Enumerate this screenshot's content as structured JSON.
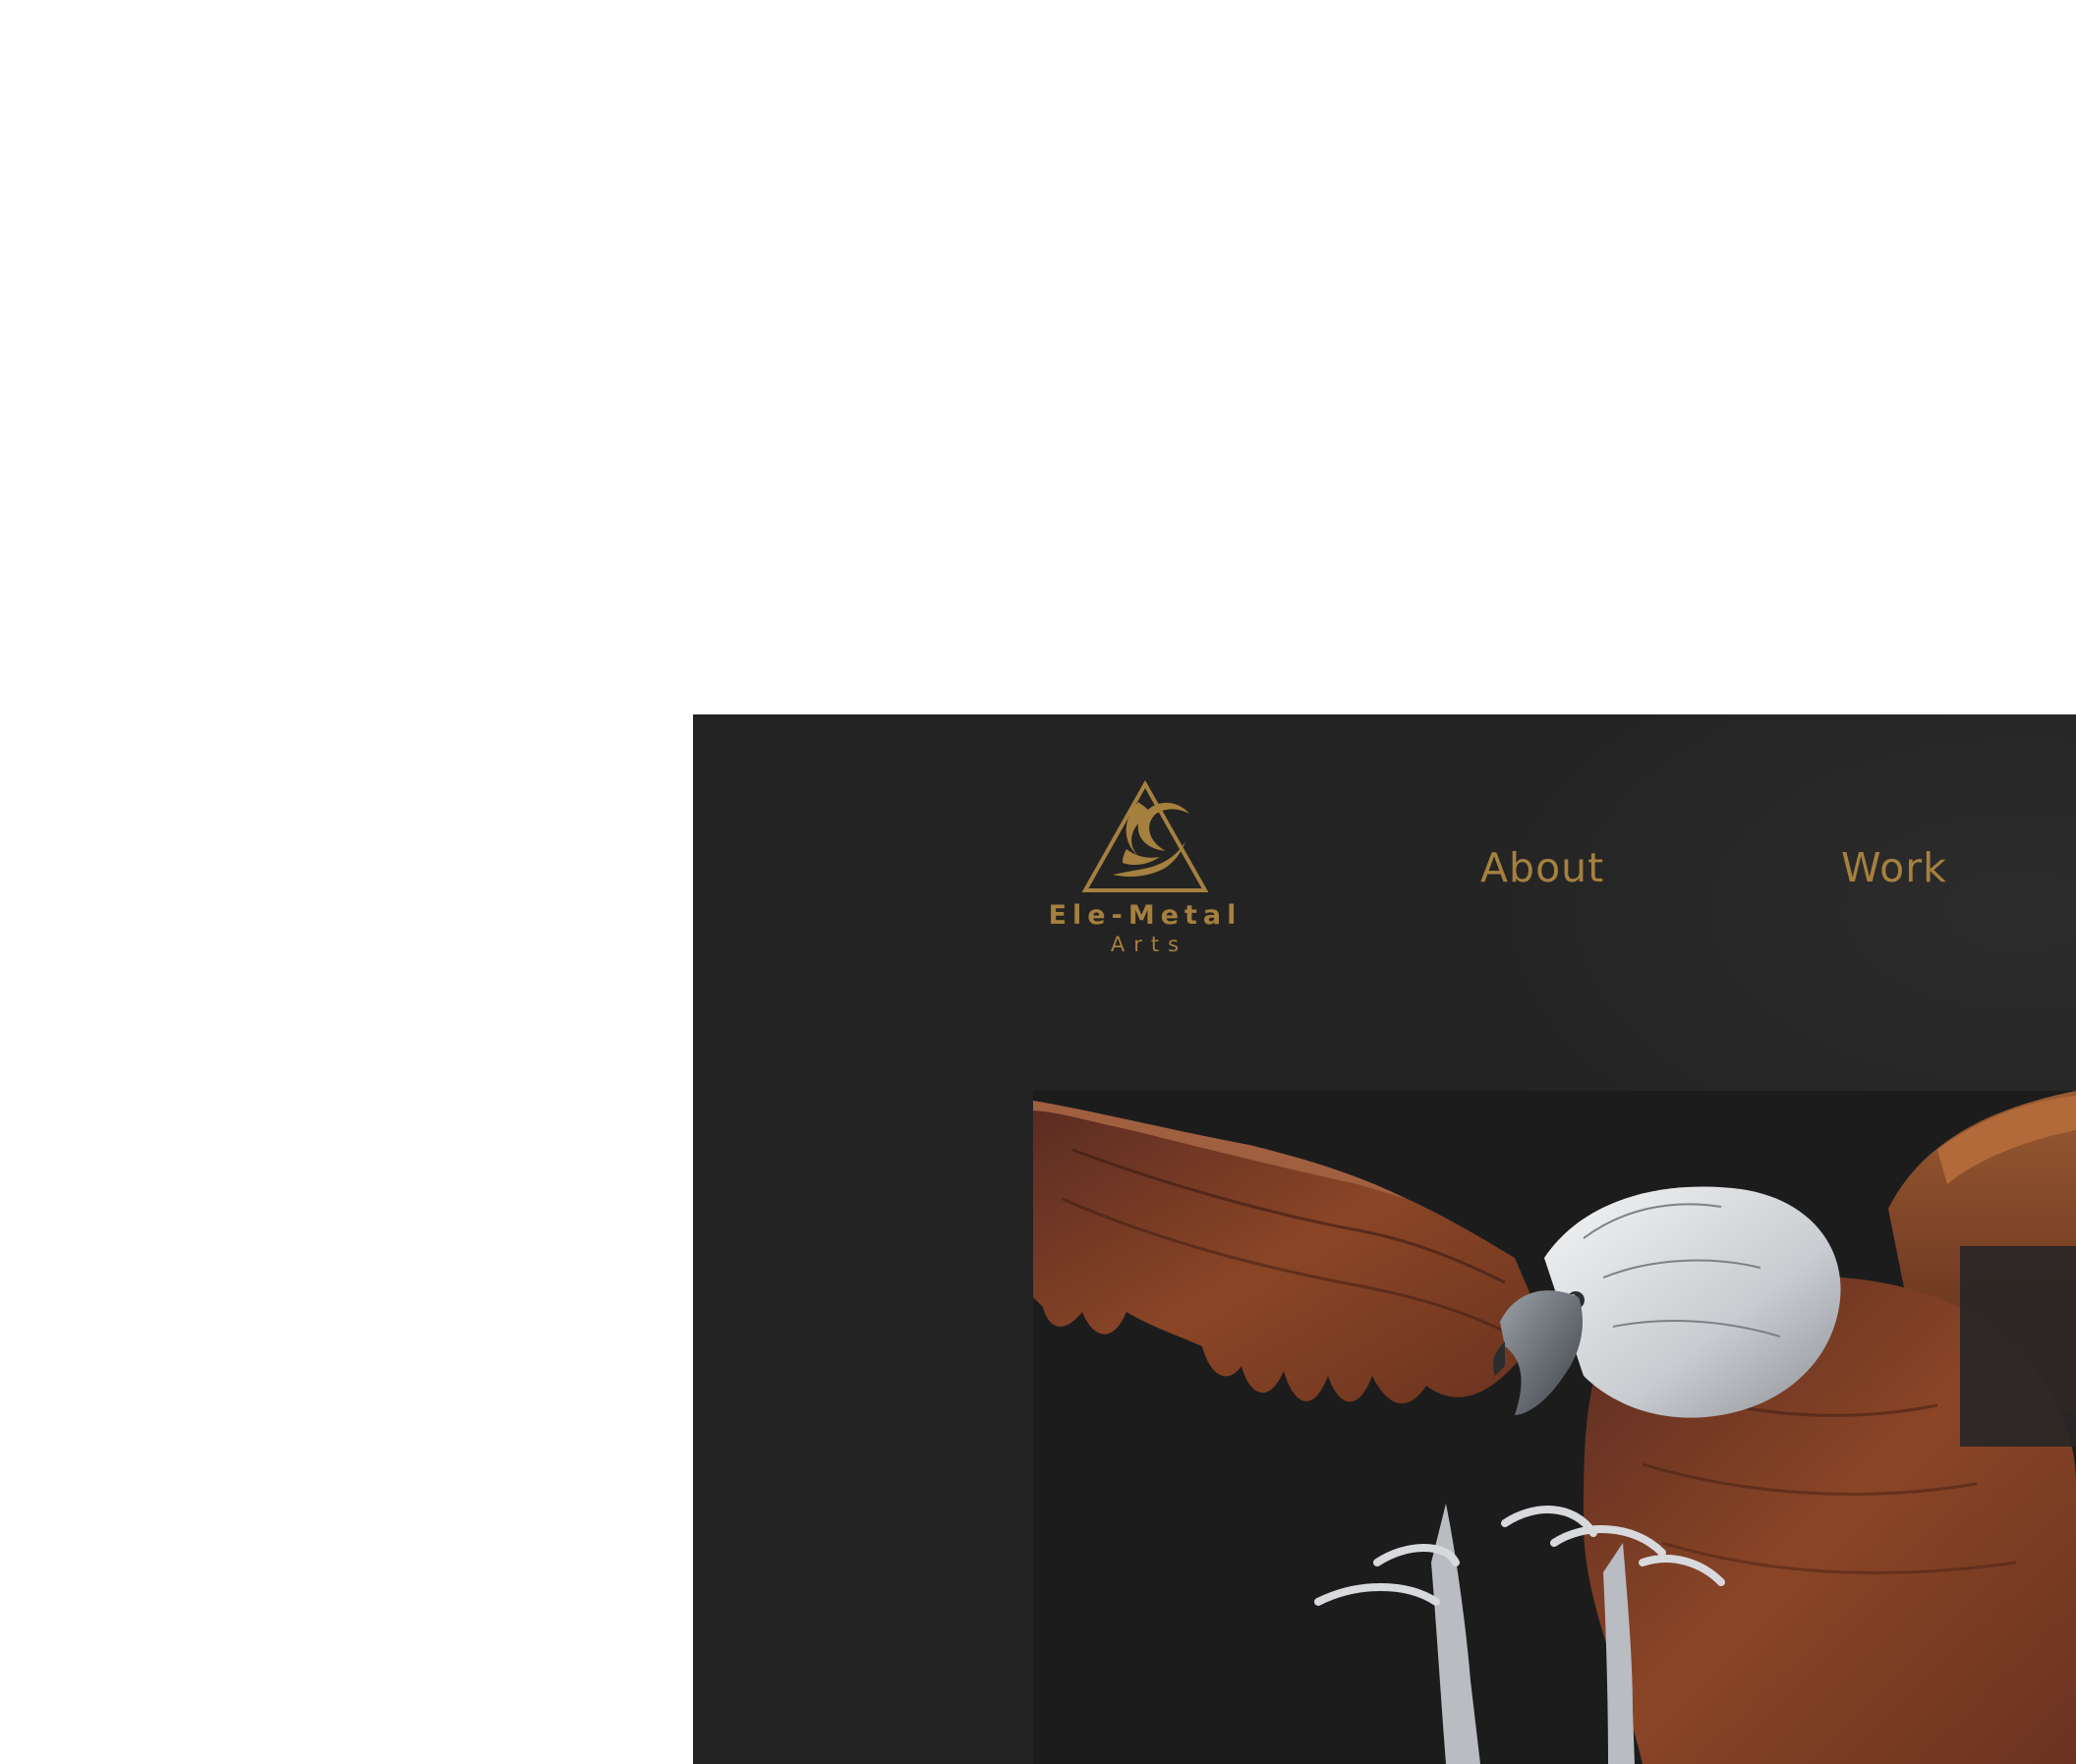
{
  "brand": {
    "name": "Ele-Metal",
    "subtitle": "Arts",
    "logo_icon": "flame-triangle-icon",
    "color": "#a5803f"
  },
  "nav": {
    "items": [
      {
        "label": "About"
      },
      {
        "label": "Work"
      }
    ]
  },
  "hero": {
    "image": "metal-eagle-sculpture",
    "colors": {
      "background": "#232323",
      "hero_bg": "#1c1c1d",
      "feather_rust": "#7a3d22",
      "feather_silver": "#d8dadc"
    }
  },
  "page": {
    "outer_background": "#fefefe"
  }
}
